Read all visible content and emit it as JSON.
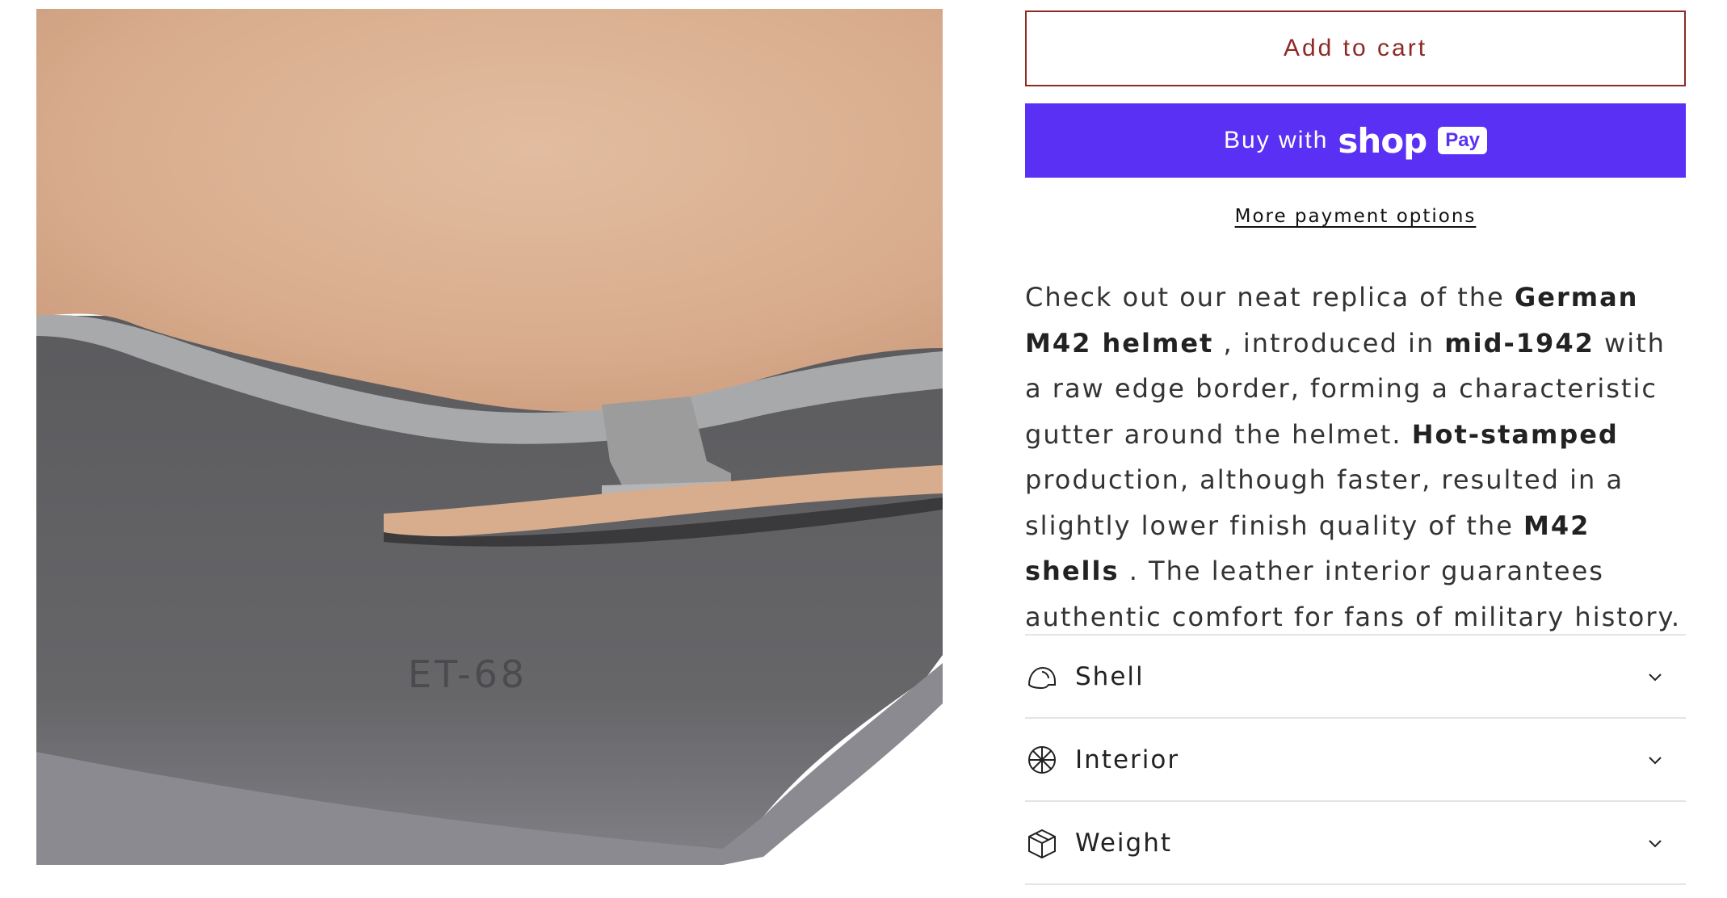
{
  "product_image": {
    "alt": "helmet interior detail",
    "stamp_text": "ET-68"
  },
  "buttons": {
    "add_to_cart": "Add to cart",
    "buy_with": "Buy with",
    "shop_logo": "shop",
    "pay_badge": "Pay",
    "more_payment": "More payment options"
  },
  "description": {
    "segments": [
      {
        "text": "Check out our neat replica of the ",
        "bold": false
      },
      {
        "text": "German M42 helmet",
        "bold": true
      },
      {
        "text": " , introduced in ",
        "bold": false
      },
      {
        "text": "mid-1942",
        "bold": true
      },
      {
        "text": " with a raw edge border, forming a characteristic gutter around the helmet. ",
        "bold": false
      },
      {
        "text": "Hot-stamped",
        "bold": true
      },
      {
        "text": " production, although faster, resulted in a slightly lower finish quality of the ",
        "bold": false
      },
      {
        "text": "M42 shells",
        "bold": true
      },
      {
        "text": " . The leather interior guarantees authentic comfort for fans of military history.",
        "bold": false
      }
    ]
  },
  "accordion": [
    {
      "label": "Shell",
      "icon": "helmet-icon"
    },
    {
      "label": "Interior",
      "icon": "interior-icon"
    },
    {
      "label": "Weight",
      "icon": "box-icon"
    }
  ],
  "colors": {
    "accent": "#8d2a26",
    "shop_pay": "#5a31f4",
    "divider": "#e4e4e4"
  }
}
